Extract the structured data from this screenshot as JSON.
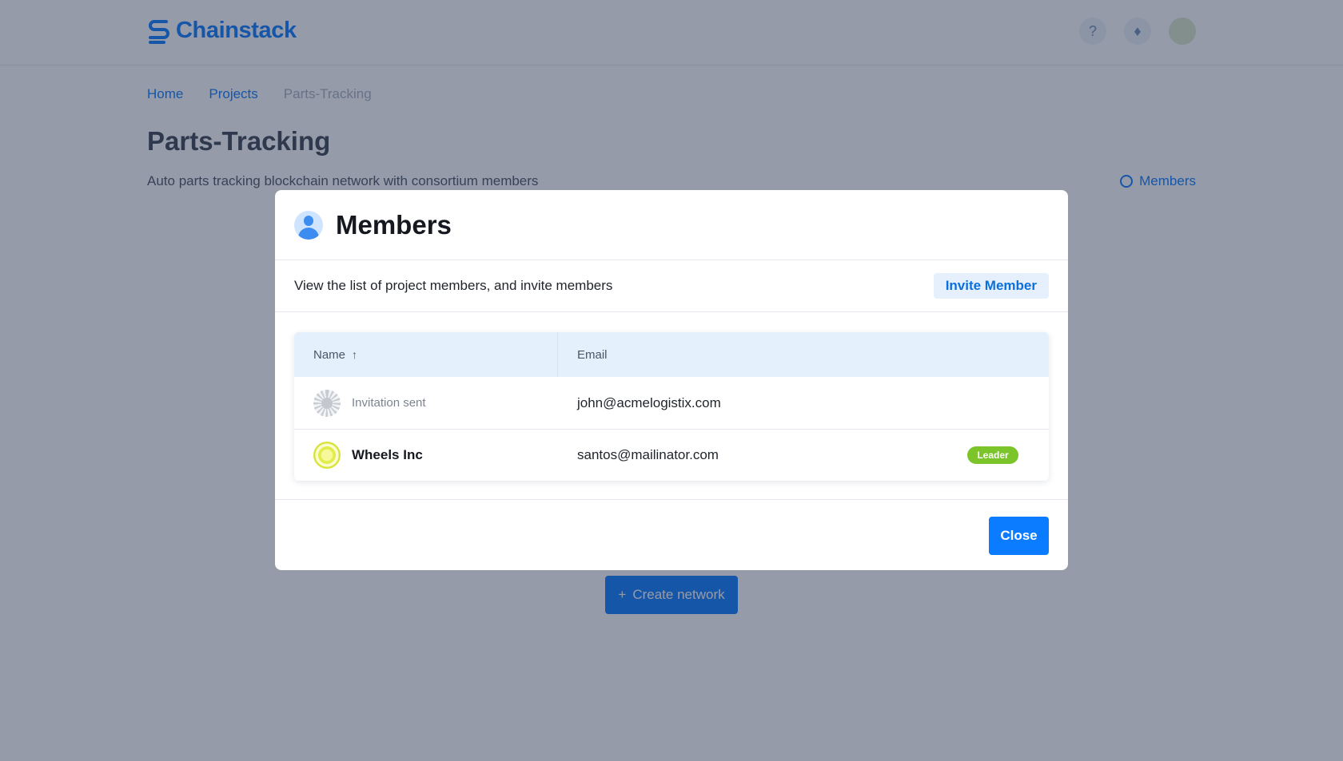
{
  "app": {
    "brand": "Chainstack",
    "icons": [
      "help-icon",
      "bell-icon",
      "user-avatar"
    ]
  },
  "breadcrumb": [
    "Home",
    "Projects",
    "Parts-Tracking"
  ],
  "project": {
    "title": "Parts-Tracking",
    "description": "Auto parts tracking blockchain network with consortium members",
    "members_link": "Members",
    "create_network": "Create network"
  },
  "modal": {
    "title": "Members",
    "subtitle": "View the list of project members, and invite members",
    "invite_label": "Invite Member",
    "columns": {
      "name": "Name",
      "email": "Email"
    },
    "members": [
      {
        "name": "Invitation sent",
        "email": "john@acmelogistix.com",
        "badge": "",
        "pending": true
      },
      {
        "name": "Wheels Inc",
        "email": "santos@mailinator.com",
        "badge": "Leader",
        "pending": false
      }
    ],
    "close_label": "Close"
  },
  "colors": {
    "primary": "#0b7bff",
    "leader_badge": "#7bc42a",
    "table_header": "#e5f0fd"
  }
}
